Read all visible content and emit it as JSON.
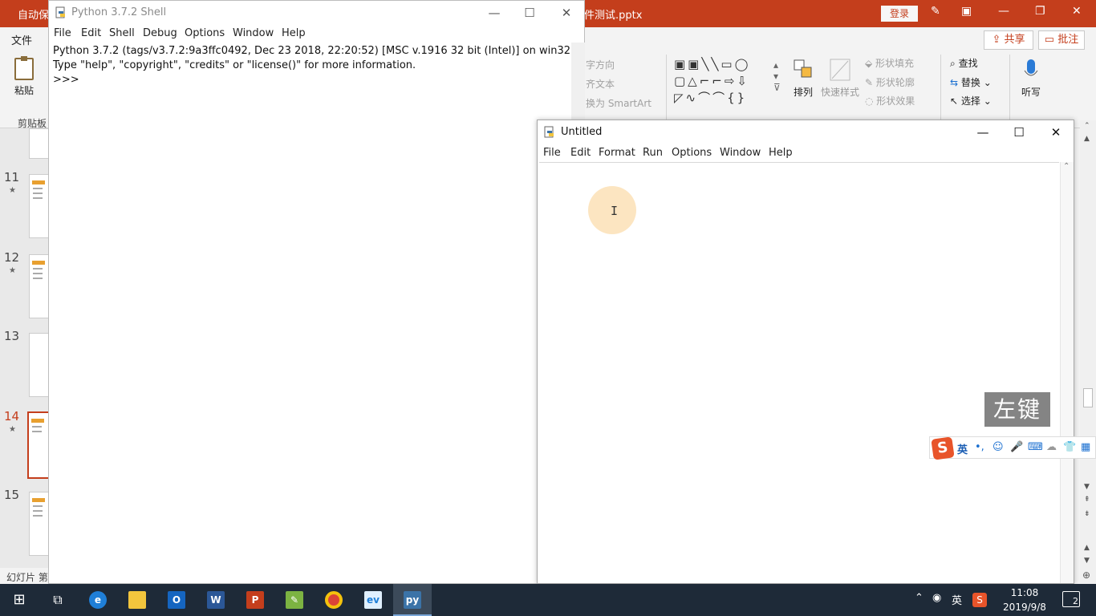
{
  "powerpoint": {
    "autosave_label": "自动保",
    "filename": "件测试.pptx",
    "login_label": "登录",
    "file_tab": "文件",
    "share_label": "共享",
    "comment_label": "批注",
    "paste_label": "粘贴",
    "clipboard_label": "剪贴板",
    "text_direction": "字方向",
    "align_text": "齐文本",
    "convert_smartart": "换为 SmartArt",
    "arrange_label": "排列",
    "quick_styles_label": "快速样式",
    "shape_fill": "形状填充",
    "shape_outline": "形状轮廓",
    "shape_effects": "形状效果",
    "find_label": "查找",
    "replace_label": "替换",
    "select_label": "选择",
    "dictate_label": "听写",
    "slides": [
      {
        "num": "11",
        "star": "★"
      },
      {
        "num": "12",
        "star": "★"
      },
      {
        "num": "13",
        "star": ""
      },
      {
        "num": "14",
        "star": "★"
      },
      {
        "num": "15",
        "star": ""
      }
    ],
    "status_text": "幻灯片 第"
  },
  "shell_window": {
    "title": "Python 3.7.2 Shell",
    "menu": [
      "File",
      "Edit",
      "Shell",
      "Debug",
      "Options",
      "Window",
      "Help"
    ],
    "lines": [
      "Python 3.7.2 (tags/v3.7.2:9a3ffc0492, Dec 23 2018, 22:20:52) [MSC v.1916 32 bit (Intel)] on win32",
      "Type \"help\", \"copyright\", \"credits\" or \"license()\" for more information.",
      ">>> "
    ]
  },
  "editor_window": {
    "title": "Untitled",
    "menu": [
      "File",
      "Edit",
      "Format",
      "Run",
      "Options",
      "Window",
      "Help"
    ]
  },
  "overlay": {
    "key_label": "左键",
    "ime_lang": "英"
  },
  "taskbar": {
    "time": "11:08",
    "date": "2019/9/8",
    "tray_lang": "英",
    "notification_count": "2"
  },
  "colors": {
    "ppt_accent": "#c43e1c",
    "taskbar_bg": "#1e2a38"
  }
}
